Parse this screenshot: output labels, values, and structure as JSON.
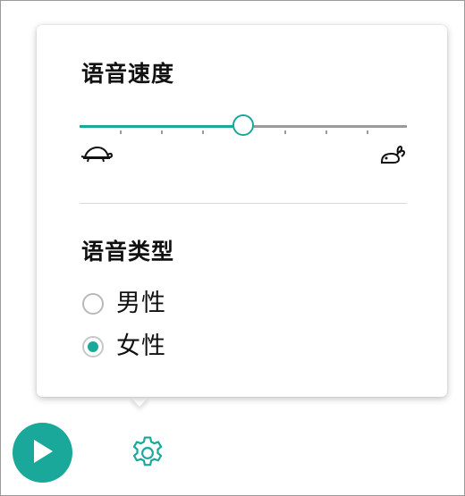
{
  "speed": {
    "title": "语音速度",
    "value_fraction": 0.5,
    "slow_icon": "turtle-icon",
    "fast_icon": "rabbit-icon"
  },
  "voice": {
    "title": "语音类型",
    "options": [
      {
        "label": "男性",
        "selected": false
      },
      {
        "label": "女性",
        "selected": true
      }
    ]
  },
  "controls": {
    "play_icon": "play-icon",
    "settings_icon": "gear-icon"
  },
  "colors": {
    "accent": "#1aa89a",
    "track_inactive": "#9a9a9a"
  }
}
